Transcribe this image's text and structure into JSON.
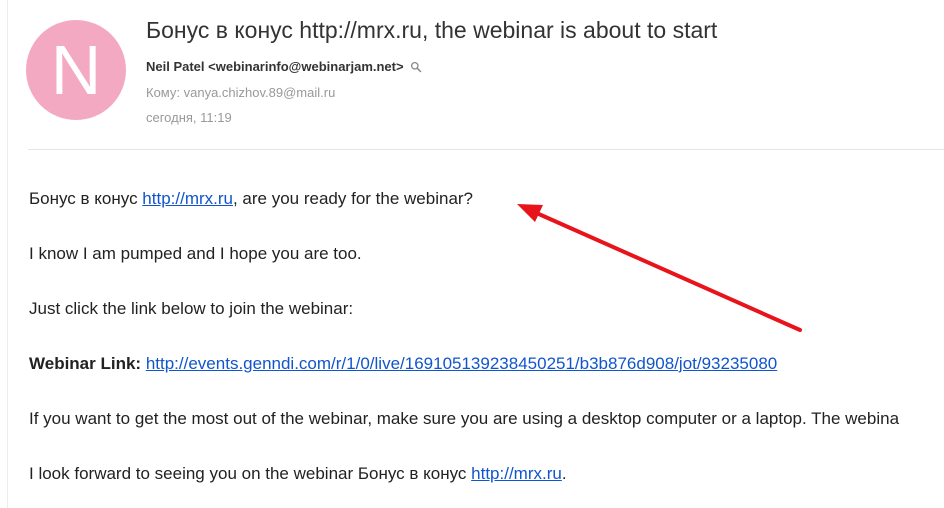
{
  "header": {
    "avatar_letter": "N",
    "avatar_color": "#f4a9c3",
    "subject": "Бонус в конус http://mrx.ru, the webinar is about to start",
    "sender": "Neil Patel <webinarinfo@webinarjam.net>",
    "recipient": "Кому: vanya.chizhov.89@mail.ru",
    "date": "сегодня, 11:19"
  },
  "body": {
    "p1_text": "Бонус в конус ",
    "p1_link": "http://mrx.ru",
    "p1_suffix": ", are you ready for the webinar?",
    "p2": "I know I am pumped and I hope you are too.",
    "p3": "Just click the link below to join the webinar:",
    "p4_label": "Webinar Link:",
    "p4_link": "http://events.genndi.com/r/1/0/live/169105139238450251/b3b876d908/jot/93235080",
    "p5": "If you want to get the most out of the webinar, make sure you are using a desktop computer or a laptop. The webina",
    "p6_text": "I look forward to seeing you on the webinar Бонус в конус ",
    "p6_link": "http://mrx.ru",
    "p6_suffix": "."
  },
  "colors": {
    "link": "#1155cc",
    "annotation_arrow": "#e8141c"
  },
  "icons": {
    "sender_search": "search-icon",
    "annotation": "red-arrow-annotation"
  }
}
